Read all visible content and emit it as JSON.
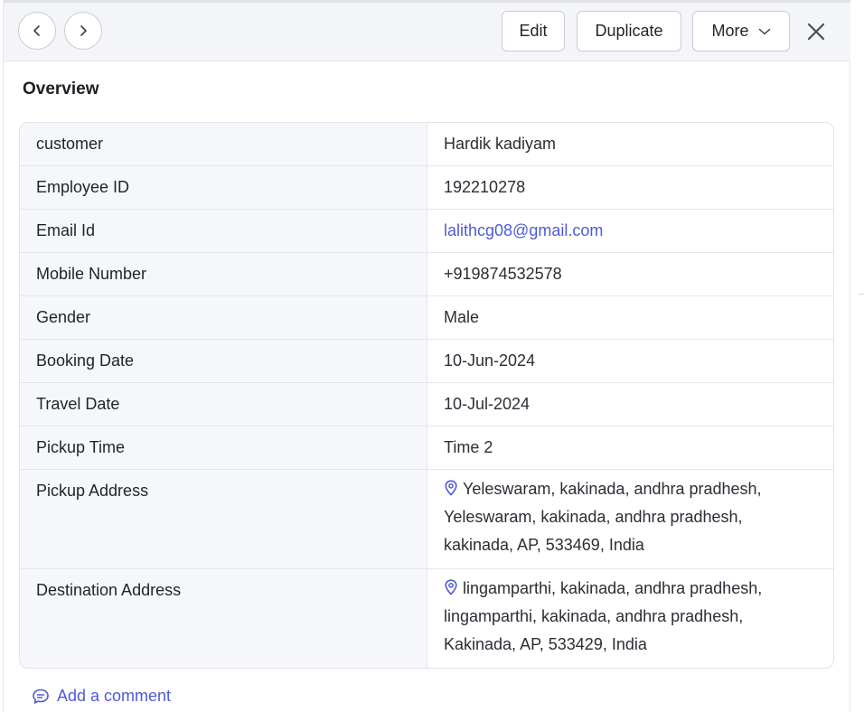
{
  "toolbar": {
    "prev_icon": "chevron-left-icon",
    "next_icon": "chevron-right-icon",
    "edit_label": "Edit",
    "duplicate_label": "Duplicate",
    "more_label": "More",
    "more_icon": "chevron-down-icon",
    "close_icon": "close-icon"
  },
  "overview": {
    "title": "Overview",
    "rows": [
      {
        "label": "customer",
        "value": "Hardik kadiyam"
      },
      {
        "label": "Employee ID",
        "value": "192210278"
      },
      {
        "label": "Email Id",
        "value": "lalithcg08@gmail.com"
      },
      {
        "label": "Mobile Number",
        "value": "+919874532578"
      },
      {
        "label": "Gender",
        "value": "Male"
      },
      {
        "label": "Booking Date",
        "value": "10-Jun-2024"
      },
      {
        "label": "Travel Date",
        "value": "10-Jul-2024"
      },
      {
        "label": "Pickup Time",
        "value": "Time 2"
      },
      {
        "label": "Pickup Address",
        "value": "Yeleswaram, kakinada, andhra pradhesh, Yeleswaram, kakinada, andhra pradhesh, kakinada, AP, 533469, India"
      },
      {
        "label": "Destination Address",
        "value": "lingamparthi, kakinada, andhra pradhesh, lingamparthi, kakinada, andhra pradhesh, Kakinada, AP, 533429, India"
      }
    ]
  },
  "comment": {
    "label": "Add a comment",
    "icon": "comment-icon"
  },
  "colors": {
    "accent": "#4f5bd5",
    "label_bg": "#f6f7fa",
    "toolbar_bg": "#f4f5f9"
  }
}
